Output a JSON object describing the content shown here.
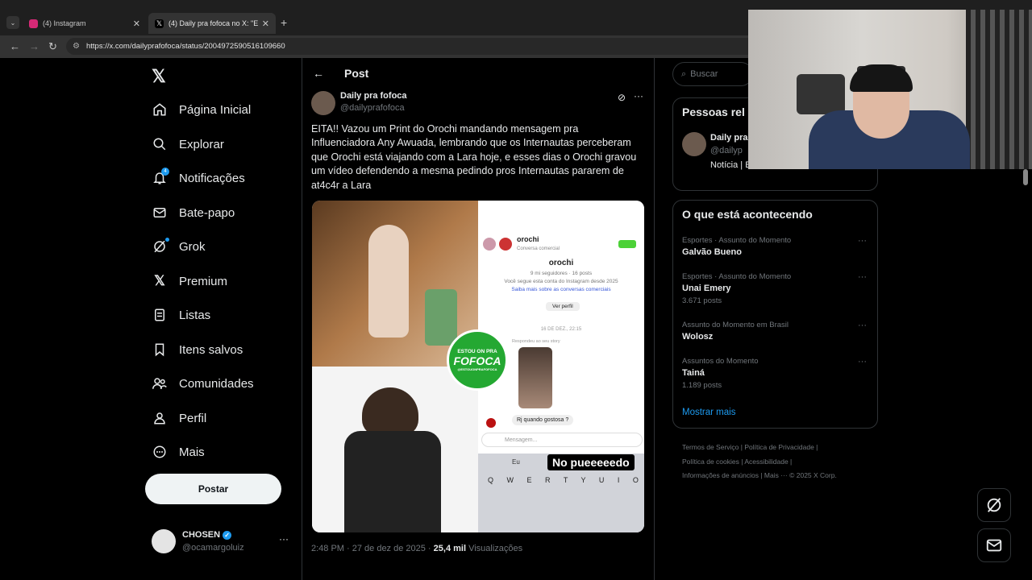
{
  "browser": {
    "tabs": [
      {
        "label": "(4) Instagram",
        "color": "#d62976"
      },
      {
        "label": "(4) Daily pra fofoca no X: \"EITA!",
        "color": "#000000"
      }
    ],
    "url": "https://x.com/dailyprafofoca/status/2004972590516109660"
  },
  "sidebar": {
    "items": [
      {
        "label": "Página Inicial",
        "icon": "home-icon"
      },
      {
        "label": "Explorar",
        "icon": "search-icon"
      },
      {
        "label": "Notificações",
        "icon": "bell-icon",
        "badge": "4"
      },
      {
        "label": "Bate-papo",
        "icon": "mail-icon"
      },
      {
        "label": "Grok",
        "icon": "grok-icon"
      },
      {
        "label": "Premium",
        "icon": "x-logo-icon"
      },
      {
        "label": "Listas",
        "icon": "list-icon"
      },
      {
        "label": "Itens salvos",
        "icon": "bookmark-icon"
      },
      {
        "label": "Comunidades",
        "icon": "people-icon"
      },
      {
        "label": "Perfil",
        "icon": "person-icon"
      },
      {
        "label": "Mais",
        "icon": "more-circle-icon"
      }
    ],
    "post_button": "Postar",
    "account": {
      "name": "CHOSEN",
      "handle": "@ocamargoluiz"
    }
  },
  "main": {
    "header": "Post",
    "post": {
      "author": "Daily pra fofoca",
      "handle": "@dailyprafofoca",
      "text": "EITA!! Vazou um Print do Orochi mandando mensagem pra Influenciadora Any Awuada, lembrando que os Internautas perceberam que Orochi está viajando com a Lara hoje, e esses dias o Orochi gravou um vídeo defendendo a mesma pedindo pros Internautas pararem de at4c4r a Lara",
      "media": {
        "profile_name": "orochi",
        "profile_sub": "Conversa comercial",
        "profile_stats": "9 mi seguidores · 16 posts",
        "profile_follow": "Você segue esta conta do Instagram desde 2025",
        "profile_link": "Saiba mais sobre as conversas comerciais",
        "profile_button": "Ver perfil",
        "date": "16 DE DEZ., 22:15",
        "story_reply": "Respondeu ao seu story",
        "message": "Rj quando gostosa ?",
        "input_placeholder": "Mensagem...",
        "keyboard_suggest": "Eu",
        "keyboard_row": "Q W E R T Y U I O",
        "logo_top": "ESTOU ON PRA",
        "logo_main": "FOFOCA",
        "logo_sub": "@ESTOUONPRAFOFOCA",
        "overlay_caption": "No pueeeeedo"
      },
      "time": "2:48 PM · 27 de dez de 2025 · ",
      "views_count": "25,4 mil",
      "views_label": " Visualizações"
    }
  },
  "right": {
    "search_placeholder": "Buscar",
    "people_title": "Pessoas rel",
    "people": {
      "name": "Daily pra",
      "handle": "@dailyp",
      "bio": "Notícia | E"
    },
    "trends_title": "O que está acontecendo",
    "trends": [
      {
        "category": "Esportes · Assunto do Momento",
        "name": "Galvão Bueno",
        "count": ""
      },
      {
        "category": "Esportes · Assunto do Momento",
        "name": "Unai Emery",
        "count": "3.671 posts"
      },
      {
        "category": "Assunto do Momento em Brasil",
        "name": "Wolosz",
        "count": ""
      },
      {
        "category": "Assuntos do Momento",
        "name": "Tainá",
        "count": "1.189 posts"
      }
    ],
    "show_more": "Mostrar mais",
    "footer": [
      "Termos de Serviço",
      "Política de Privacidade",
      "Política de cookies",
      "Acessibilidade",
      "Informações de anúncios",
      "Mais ···",
      "© 2025 X Corp."
    ]
  }
}
